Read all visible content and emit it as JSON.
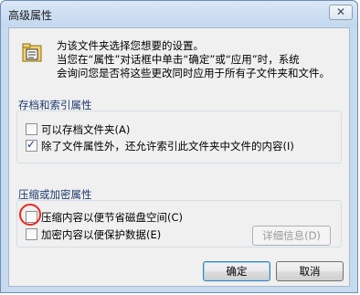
{
  "window": {
    "title": "高级属性",
    "close_glyph": "✕"
  },
  "intro": {
    "line1": "为该文件夹选择您想要的设置。",
    "line2": "当您在“属性”对话框中单击“确定”或“应用”时，系统",
    "line3": "会询问您是否将这些更改同时应用于所有子文件夹和文件。"
  },
  "archive_group": {
    "label": "存档和索引属性",
    "archive_checkbox": {
      "label": "可以存档文件夹(A)",
      "checked": false
    },
    "index_checkbox": {
      "label": "除了文件属性外，还允许索引此文件夹中文件的内容(I)",
      "checked": true
    }
  },
  "compress_group": {
    "label": "压缩或加密属性",
    "compress_checkbox": {
      "label": "压缩内容以便节省磁盘空间(C)",
      "checked": false
    },
    "encrypt_checkbox": {
      "label": "加密内容以便保护数据(E)",
      "checked": false
    },
    "details_button": "详细信息(D)"
  },
  "buttons": {
    "ok": "确定",
    "cancel": "取消"
  },
  "colors": {
    "highlight_circle": "#e8261e",
    "group_label": "#1e3b6e"
  },
  "icons": [
    "folder-properties-icon",
    "close-icon",
    "checkmark-icon"
  ]
}
